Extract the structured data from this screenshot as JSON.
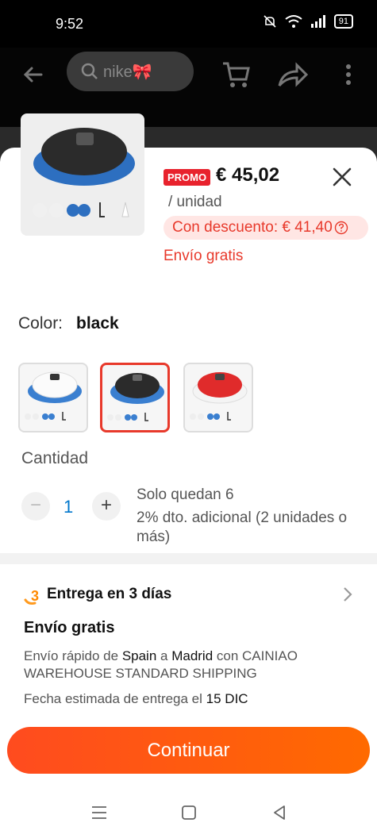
{
  "status_bar": {
    "time": "9:52",
    "battery": "91"
  },
  "search": {
    "value": "nike🎀"
  },
  "product": {
    "promo_label": "PROMO",
    "price": "€ 45,02",
    "unit": "/ unidad",
    "discount_text": "Con descuento: € 41,40",
    "shipping": "Envío gratis"
  },
  "color": {
    "label": "Color:",
    "value": "black",
    "options": [
      "white",
      "black",
      "red"
    ],
    "selected_index": 1
  },
  "quantity": {
    "label": "Cantidad",
    "value": "1",
    "minus": "−",
    "plus": "+",
    "stock_left": "Solo quedan 6",
    "bulk_discount": "2% dto. adicional (2 unidades o más)"
  },
  "delivery": {
    "title": "Entrega en 3 días",
    "free_shipping": "Envío gratis",
    "route_prefix": "Envío rápido de ",
    "route_from": "Spain",
    "route_mid": " a ",
    "route_to": "Madrid",
    "route_suffix": " con CAINIAO WAREHOUSE STANDARD SHIPPING",
    "eta_prefix": "Fecha estimada de entrega el ",
    "eta_date": "15 DIC"
  },
  "cta": {
    "label": "Continuar"
  },
  "colors": {
    "accent": "#e8392b",
    "cta_start": "#ff4b1f",
    "cta_end": "#ff6a00",
    "promo": "#e8222d",
    "qty": "#0077cc"
  }
}
